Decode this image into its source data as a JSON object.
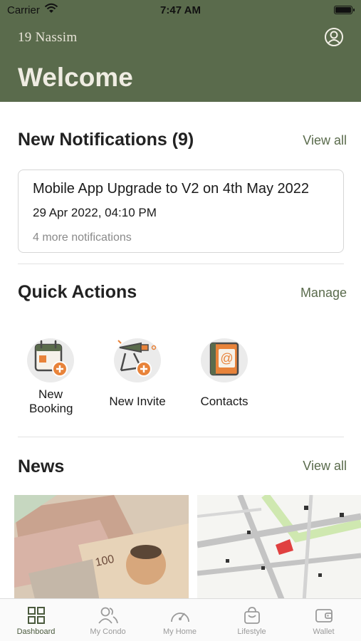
{
  "status_bar": {
    "carrier": "Carrier",
    "time": "7:47 AM"
  },
  "header": {
    "brand": "19 Nassim",
    "welcome": "Welcome",
    "profile_icon": "user-circle-icon"
  },
  "notifications": {
    "title": "New Notifications (9)",
    "view_all": "View all",
    "card": {
      "title": "Mobile App Upgrade to V2 on 4th May 2022",
      "date": "29 Apr 2022, 04:10 PM",
      "more": "4 more notifications"
    }
  },
  "quick_actions": {
    "title": "Quick Actions",
    "manage": "Manage",
    "items": [
      {
        "label": "New Booking",
        "icon": "calendar-add-icon"
      },
      {
        "label": "New Invite",
        "icon": "trumpet-add-icon"
      },
      {
        "label": "Contacts",
        "icon": "contact-book-icon"
      }
    ]
  },
  "news": {
    "title": "News",
    "view_all": "View all"
  },
  "tabbar": {
    "items": [
      {
        "label": "Dashboard",
        "icon": "grid-icon",
        "active": true
      },
      {
        "label": "My Condo",
        "icon": "people-icon"
      },
      {
        "label": "My Home",
        "icon": "gauge-icon"
      },
      {
        "label": "Lifestyle",
        "icon": "shopping-bag-icon"
      },
      {
        "label": "Wallet",
        "icon": "wallet-icon"
      }
    ]
  },
  "colors": {
    "brand_green": "#5a6b4c",
    "accent_orange": "#e8833a",
    "header_text": "#efece2"
  }
}
